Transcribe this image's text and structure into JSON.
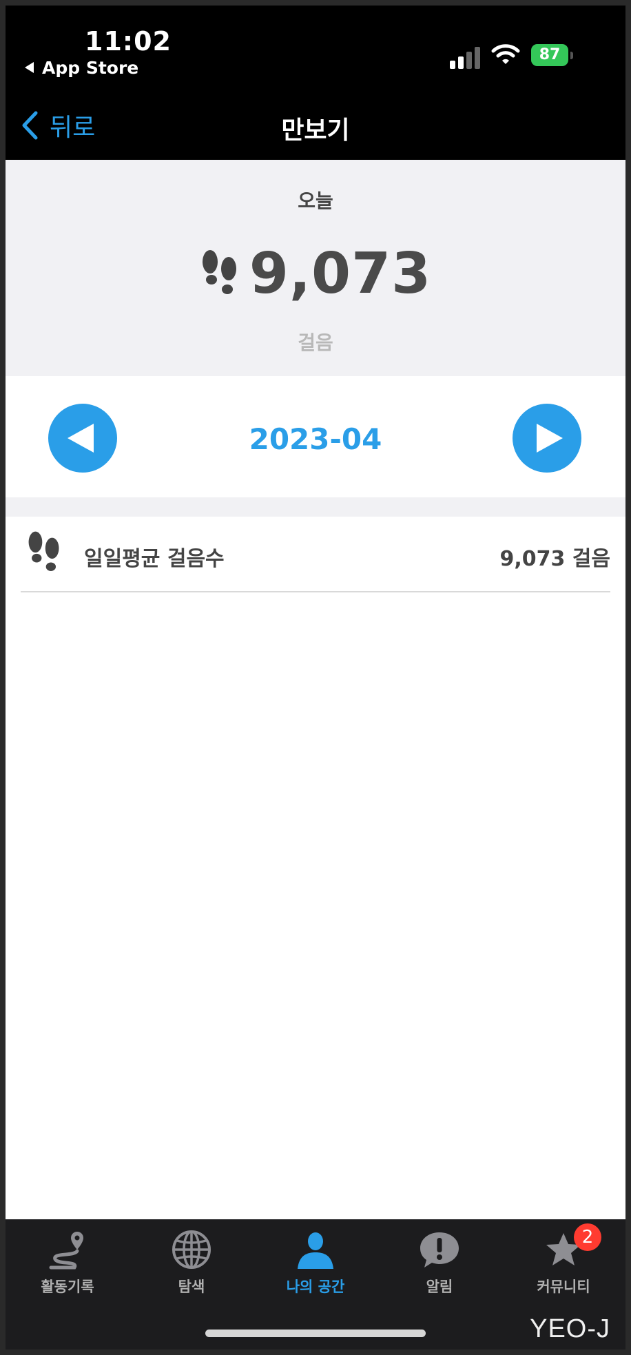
{
  "status_bar": {
    "time": "11:02",
    "back_app": "App Store",
    "battery": "87"
  },
  "nav": {
    "back_label": "뒤로",
    "title": "만보기"
  },
  "today": {
    "label": "오늘",
    "steps": "9,073",
    "unit": "걸음"
  },
  "month_selector": {
    "month": "2023-04"
  },
  "stats": [
    {
      "label": "일일평균 걸음수",
      "value": "9,073 걸음"
    }
  ],
  "tabs": [
    {
      "label": "활동기록",
      "icon": "route-pin-icon",
      "active": false
    },
    {
      "label": "탐색",
      "icon": "globe-icon",
      "active": false
    },
    {
      "label": "나의 공간",
      "icon": "person-icon",
      "active": true
    },
    {
      "label": "알림",
      "icon": "alert-bubble-icon",
      "active": false
    },
    {
      "label": "커뮤니티",
      "icon": "star-icon",
      "active": false,
      "badge": "2"
    }
  ],
  "watermark": "YEO-J",
  "colors": {
    "accent": "#2a9ee8",
    "battery": "#34c759",
    "badge": "#ff3b30",
    "tabbar_bg": "#1c1c1e"
  }
}
